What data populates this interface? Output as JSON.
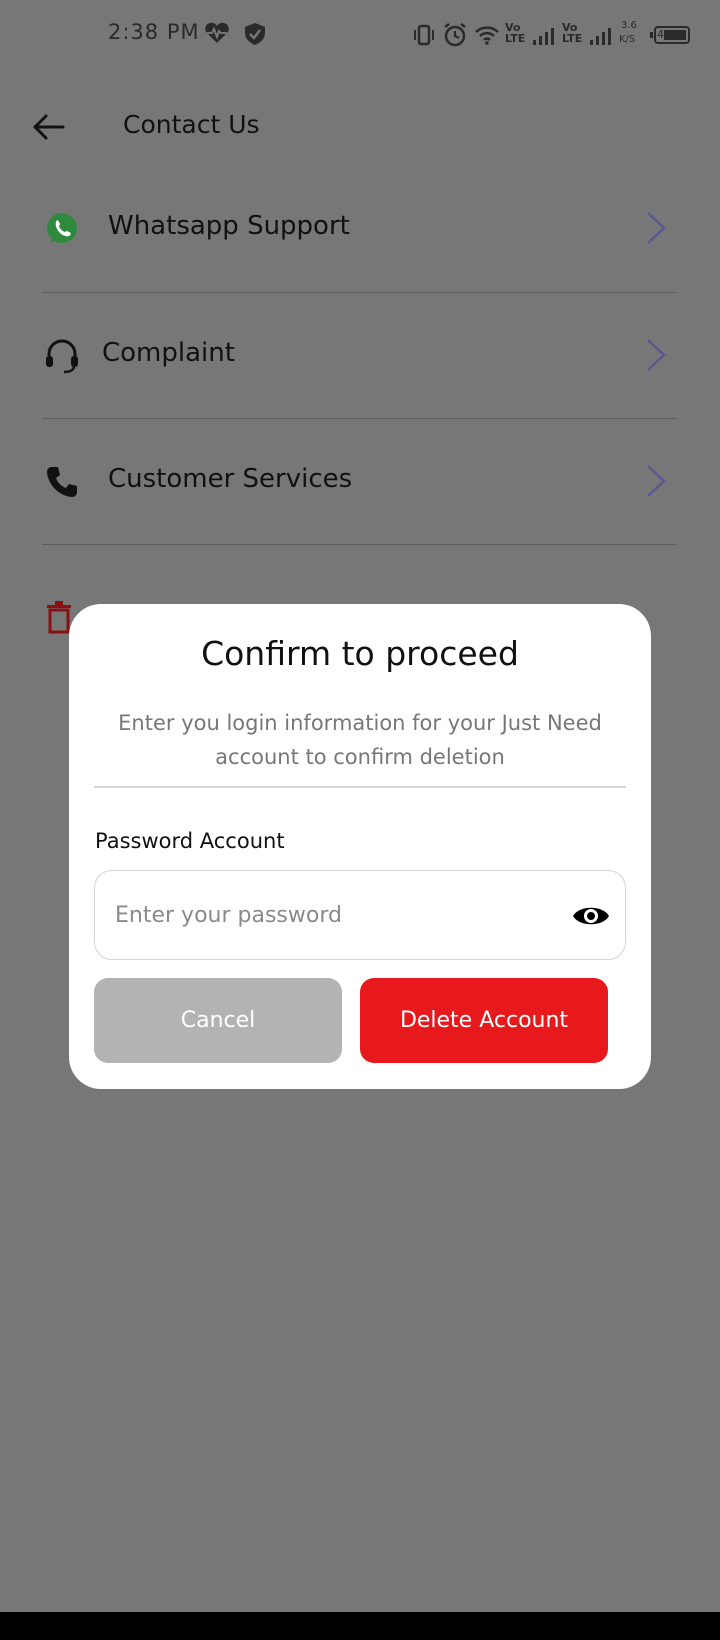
{
  "status_bar": {
    "time": "2:38 PM",
    "net_speed_value": "3.6",
    "net_speed_unit": "K/S",
    "sim1_label": "Vo LTE",
    "sim2_label": "Vo LTE",
    "battery": "46",
    "icons": [
      "heartbeat-icon",
      "shield-icon",
      "vibrate-icon",
      "alarm-icon",
      "wifi-icon",
      "signal-icon",
      "battery-icon"
    ]
  },
  "header": {
    "title": "Contact Us",
    "back_icon": "arrow-left-icon"
  },
  "menu": {
    "items": [
      {
        "label": "Whatsapp Support",
        "icon": "whatsapp-icon"
      },
      {
        "label": "Complaint",
        "icon": "headset-icon"
      },
      {
        "label": "Customer Services",
        "icon": "phone-icon"
      }
    ],
    "hidden_item_icon": "trash-icon"
  },
  "dialog": {
    "title": "Confirm to proceed",
    "message": "Enter you login information for your Just Need account to confirm deletion",
    "password_label": "Password Account",
    "password_placeholder": "Enter your password",
    "password_value": "",
    "cancel_label": "Cancel",
    "delete_label": "Delete Account"
  },
  "colors": {
    "overlay_background": "#777777",
    "dialog_background": "#ffffff",
    "cancel_button": "#b3b3b3",
    "delete_button": "#e8191c",
    "chevron": "#5a5890",
    "whatsapp_green": "#2f8a3e",
    "trash_red": "#8a1111"
  }
}
